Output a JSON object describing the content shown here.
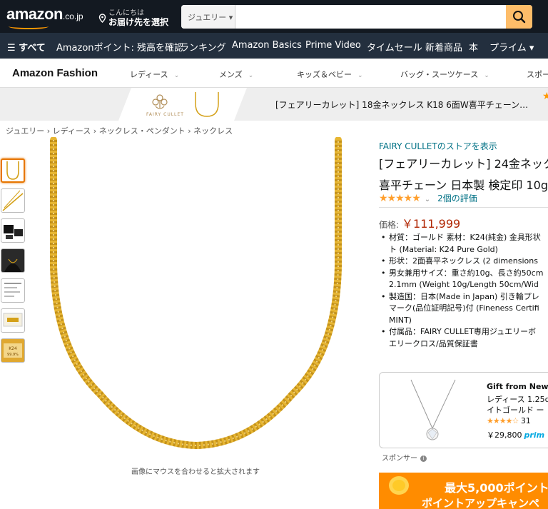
{
  "header": {
    "logo_text": "amazon",
    "logo_suffix": ".co.jp",
    "deliver_line1": "こんにちは",
    "deliver_line2": "お届け先を選択",
    "search_category": "ジュエリー ▾",
    "search_placeholder": "",
    "search_icon": "magnifier-icon"
  },
  "nav": {
    "items": [
      "☰ すべて",
      "Amazonポイント: 残高を確認",
      "ランキング",
      "Amazon Basics",
      "Prime Video",
      "タイムセール",
      "新着商品",
      "本",
      "プライム ▾"
    ]
  },
  "fashion_nav": {
    "brand": "Amazon Fashion",
    "items": [
      "レディース",
      "メンズ",
      "キッズ＆ベビー",
      "バッグ・スーツケース",
      "スポー"
    ]
  },
  "banner": {
    "brand_logo": "FAIRY CULLET",
    "title": "[フェアリーカレット] 18金ネックレス K18 6面W喜平チェーン…"
  },
  "breadcrumb": "ジュエリー › レディース › ネックレス・ペンダント › ネックレス",
  "gallery": {
    "thumb_7_text": "K24純金 純度99.9%",
    "hover_hint": "画像にマウスを合わせると拡大されます"
  },
  "product": {
    "store_link": "FAIRY CULLETのストアを表示",
    "title_line1": "[フェアリーカレット] 24金ネック",
    "title_line2": "喜平チェーン 日本製 検定印 10g",
    "stars": "★★★★★",
    "rating_chevron": "⌄",
    "rating_count": "2個の評価",
    "price_label": "価格:",
    "price": "￥111,999",
    "bullets": [
      [
        "材質：ゴールド 素材：K24(純金) 金具形状",
        "ト (Material: K24 Pure Gold)"
      ],
      [
        "形状：2面喜平ネックレス (2 dimensions"
      ],
      [
        "男女兼用サイズ：重さ約10g、長さ約50cm",
        "2.1mm (Weight 10g/Length 50cm/Wid"
      ],
      [
        "製造国：日本(Made in Japan) 引き輪プレ",
        "マーク(品位証明記号)付 (Fineness Certifi",
        "MINT)"
      ],
      [
        "付属品：FAIRY CULLET専用ジュエリーボ",
        "エリークロス/品質保証書"
      ]
    ]
  },
  "sponsored": {
    "title": "Gift from New Y",
    "line2": "レディース 1.25c",
    "line3": "イトゴールド ー",
    "stars": "★★★★☆",
    "review_count": "31",
    "price": "￥29,800",
    "prime": "prim",
    "label": "スポンサー",
    "info_icon": "i"
  },
  "promo": {
    "line1": "最大5,000ポイント",
    "line2": "ポイントアップキャンペ"
  },
  "colors": {
    "topbar": "#131921",
    "navbar": "#232f3e",
    "search_button": "#febd69",
    "gold": "#d4a017",
    "price_red": "#b12704",
    "link": "#007185"
  }
}
